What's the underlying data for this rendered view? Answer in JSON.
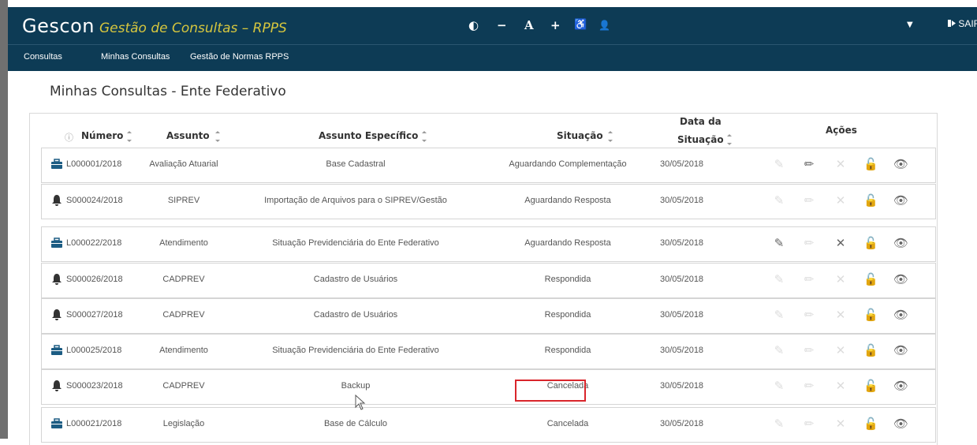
{
  "app": {
    "brand_name": "Gescon",
    "brand_subtitle": "Gestão de Consultas – RPPS",
    "toolbar": {
      "contrast": "◐",
      "decrease_font": "−",
      "font": "A",
      "increase_font": "+",
      "accessibility": "♿",
      "user": "👤",
      "dropdown": "▼",
      "logout_label": "SAIR"
    }
  },
  "nav": [
    "Consultas",
    "Minhas Consultas",
    "Gestão de Normas RPPS"
  ],
  "page_title": "Minhas Consultas - Ente Federativo",
  "table": {
    "headers": {
      "info": "ⓘ",
      "numero": "Número",
      "assunto": "Assunto",
      "especifico": "Assunto Específico",
      "situacao": "Situação",
      "data_line1": "Data da",
      "data_line2": "Situação",
      "acoes": "Ações"
    },
    "rows": [
      {
        "icon": "briefcase-icon",
        "numero": "L000001/2018",
        "assunto": "Avaliação Atuarial",
        "especifico": "Base Cadastral",
        "situacao": "Aguardando Complementação",
        "data": "30/05/2018",
        "acoes": [
          "dim",
          "dark",
          "dim",
          "dim",
          "dark"
        ]
      },
      {
        "icon": "bell-icon",
        "numero": "S000024/2018",
        "assunto": "SIPREV",
        "especifico": "Importação de Arquivos para o SIPREV/Gestão",
        "situacao": "Aguardando Resposta",
        "data": "30/05/2018",
        "acoes": [
          "dim",
          "dim",
          "dim",
          "dim",
          "dark"
        ]
      },
      {
        "icon": "briefcase-icon",
        "numero": "L000022/2018",
        "assunto": "Atendimento",
        "especifico": "Situação Previdenciária do Ente Federativo",
        "situacao": "Aguardando Resposta",
        "data": "30/05/2018",
        "acoes": [
          "dark",
          "dim",
          "dark",
          "dim",
          "dark"
        ]
      },
      {
        "icon": "bell-icon",
        "numero": "S000026/2018",
        "assunto": "CADPREV",
        "especifico": "Cadastro de Usuários",
        "situacao": "Respondida",
        "data": "30/05/2018",
        "acoes": [
          "dim",
          "dim",
          "dim",
          "dark",
          "dark"
        ]
      },
      {
        "icon": "bell-icon",
        "numero": "S000027/2018",
        "assunto": "CADPREV",
        "especifico": "Cadastro de Usuários",
        "situacao": "Respondida",
        "data": "30/05/2018",
        "acoes": [
          "dim",
          "dim",
          "dim",
          "dark",
          "dark"
        ]
      },
      {
        "icon": "briefcase-icon",
        "numero": "L000025/2018",
        "assunto": "Atendimento",
        "especifico": "Situação Previdenciária do Ente Federativo",
        "situacao": "Respondida",
        "data": "30/05/2018",
        "acoes": [
          "dim",
          "dim",
          "dim",
          "dark",
          "dark"
        ]
      },
      {
        "icon": "bell-icon",
        "numero": "S000023/2018",
        "assunto": "CADPREV",
        "especifico": "Backup",
        "situacao": "Cancelada",
        "data": "30/05/2018",
        "acoes": [
          "dim",
          "dim",
          "dim",
          "dim",
          "dark"
        ]
      },
      {
        "icon": "briefcase-icon",
        "numero": "L000021/2018",
        "assunto": "Legislação",
        "especifico": "Base de Cálculo",
        "situacao": "Cancelada",
        "data": "30/05/2018",
        "acoes": [
          "dim",
          "dim",
          "dim",
          "dim",
          "dark"
        ]
      }
    ]
  },
  "colors": {
    "topbar": "#0d3b55",
    "brand_subtitle": "#d6c63e",
    "highlight": "#d9252b",
    "header_icon": "#1c5c83"
  }
}
